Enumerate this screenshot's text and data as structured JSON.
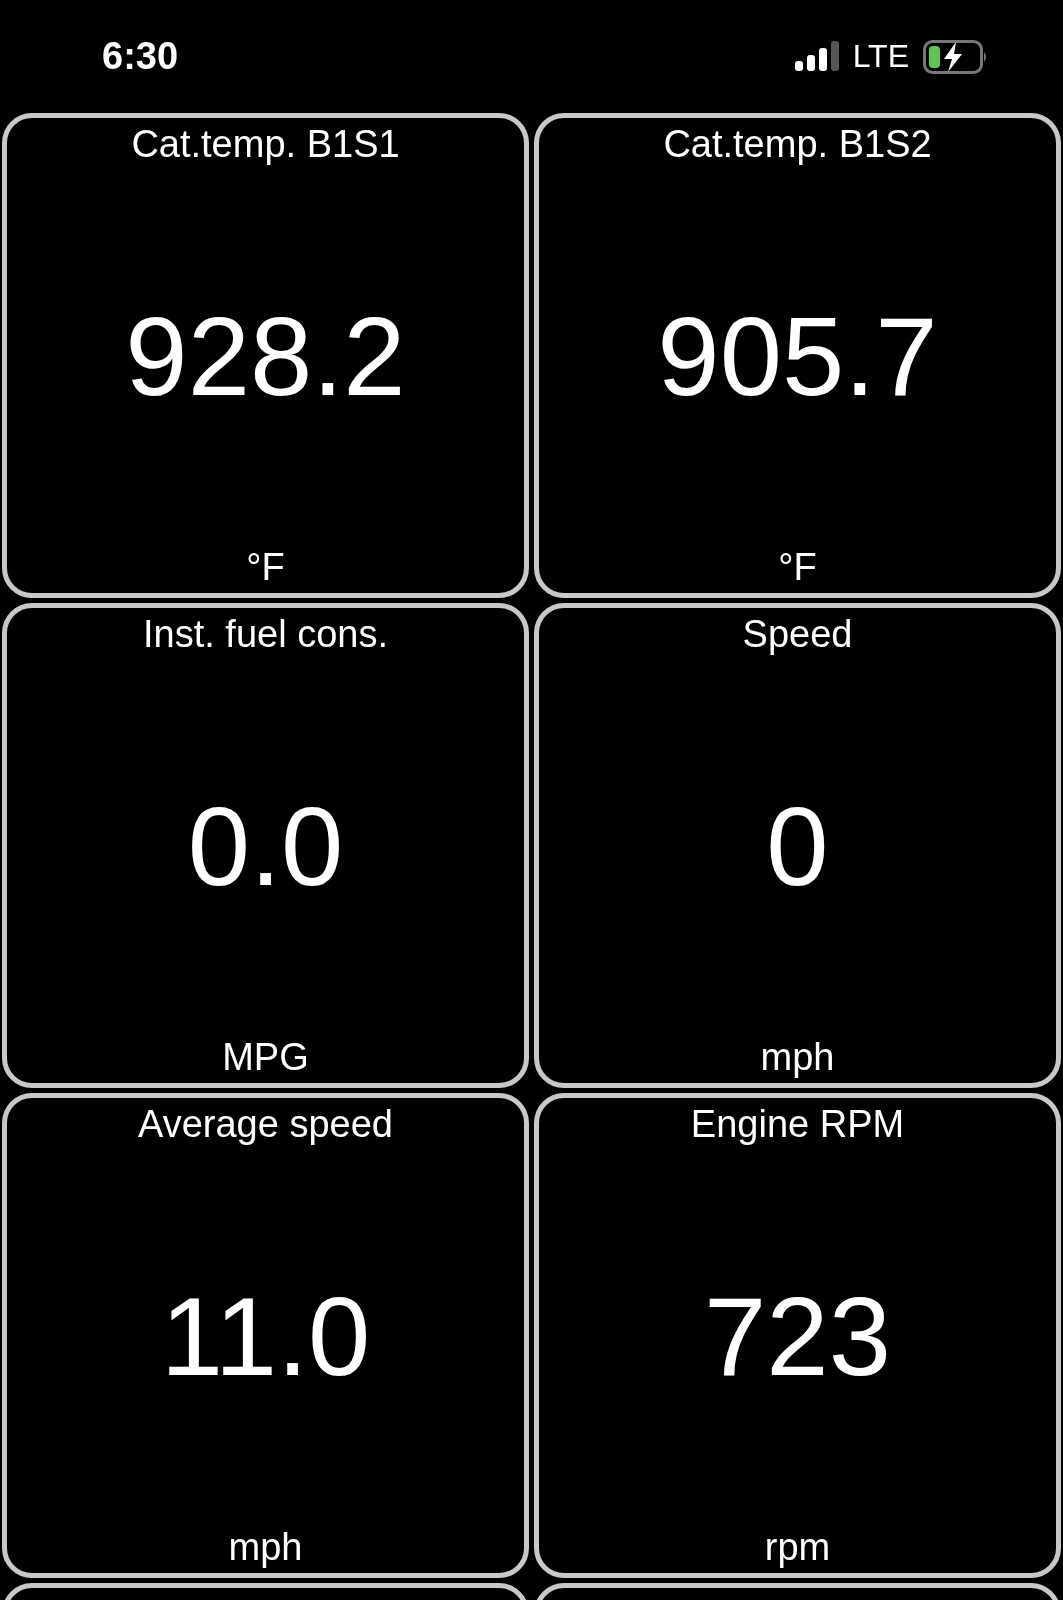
{
  "status_bar": {
    "time": "6:30",
    "network": "LTE"
  },
  "tiles": [
    {
      "title": "Cat.temp. B1S1",
      "value": "928.2",
      "unit": "°F"
    },
    {
      "title": "Cat.temp. B1S2",
      "value": "905.7",
      "unit": "°F"
    },
    {
      "title": "Inst. fuel cons.",
      "value": "0.0",
      "unit": "MPG"
    },
    {
      "title": "Speed",
      "value": "0",
      "unit": "mph"
    },
    {
      "title": "Average speed",
      "value": "11.0",
      "unit": "mph"
    },
    {
      "title": "Engine RPM",
      "value": "723",
      "unit": "rpm"
    }
  ]
}
